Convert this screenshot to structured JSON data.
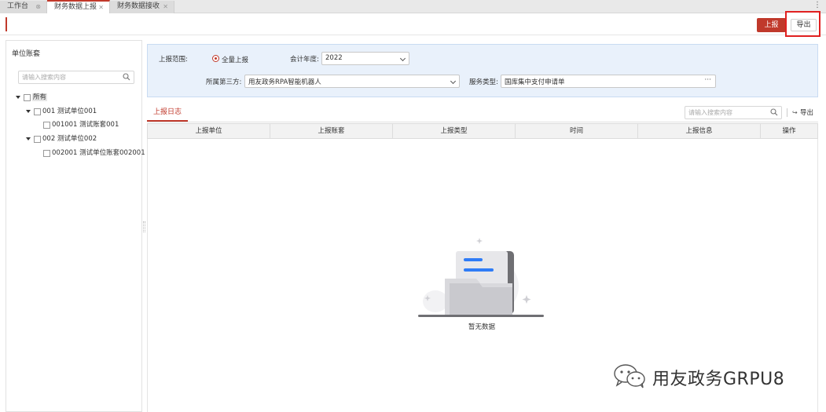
{
  "tabs": [
    {
      "label": "工作台",
      "active": false
    },
    {
      "label": "财务数据上报",
      "active": true
    },
    {
      "label": "财务数据接收",
      "active": false
    }
  ],
  "toolbar": {
    "report_label": "上报",
    "export_label": "导出",
    "accent_color": "#c0392b",
    "highlight_color": "#e02020"
  },
  "left_panel": {
    "title": "单位账套",
    "search_placeholder": "请输入搜索内容",
    "tree": {
      "root": "所有",
      "unit1": "001 测试单位001",
      "unit1_book": "001001 测试账套001",
      "unit2": "002 测试单位002",
      "unit2_book": "002001 测试单位账套002001"
    }
  },
  "filter": {
    "scope_label": "上报范围:",
    "scope_option": "全量上报",
    "year_label": "会计年度:",
    "year_value": "2022",
    "third_party_label": "所属第三方:",
    "third_party_value": "用友政务RPA智能机器人",
    "service_label": "服务类型:",
    "service_value": "国库集中支付申请单",
    "background_color": "#e9f1fb"
  },
  "log": {
    "tab_label": "上报日志",
    "search_placeholder": "请输入搜索内容",
    "export_label": "导出",
    "columns": [
      "上报单位",
      "上报账套",
      "上报类型",
      "时间",
      "上报信息",
      "操作"
    ],
    "rows": [],
    "empty_text": "暂无数据"
  },
  "watermark": {
    "text": "用友政务GRPU8"
  }
}
